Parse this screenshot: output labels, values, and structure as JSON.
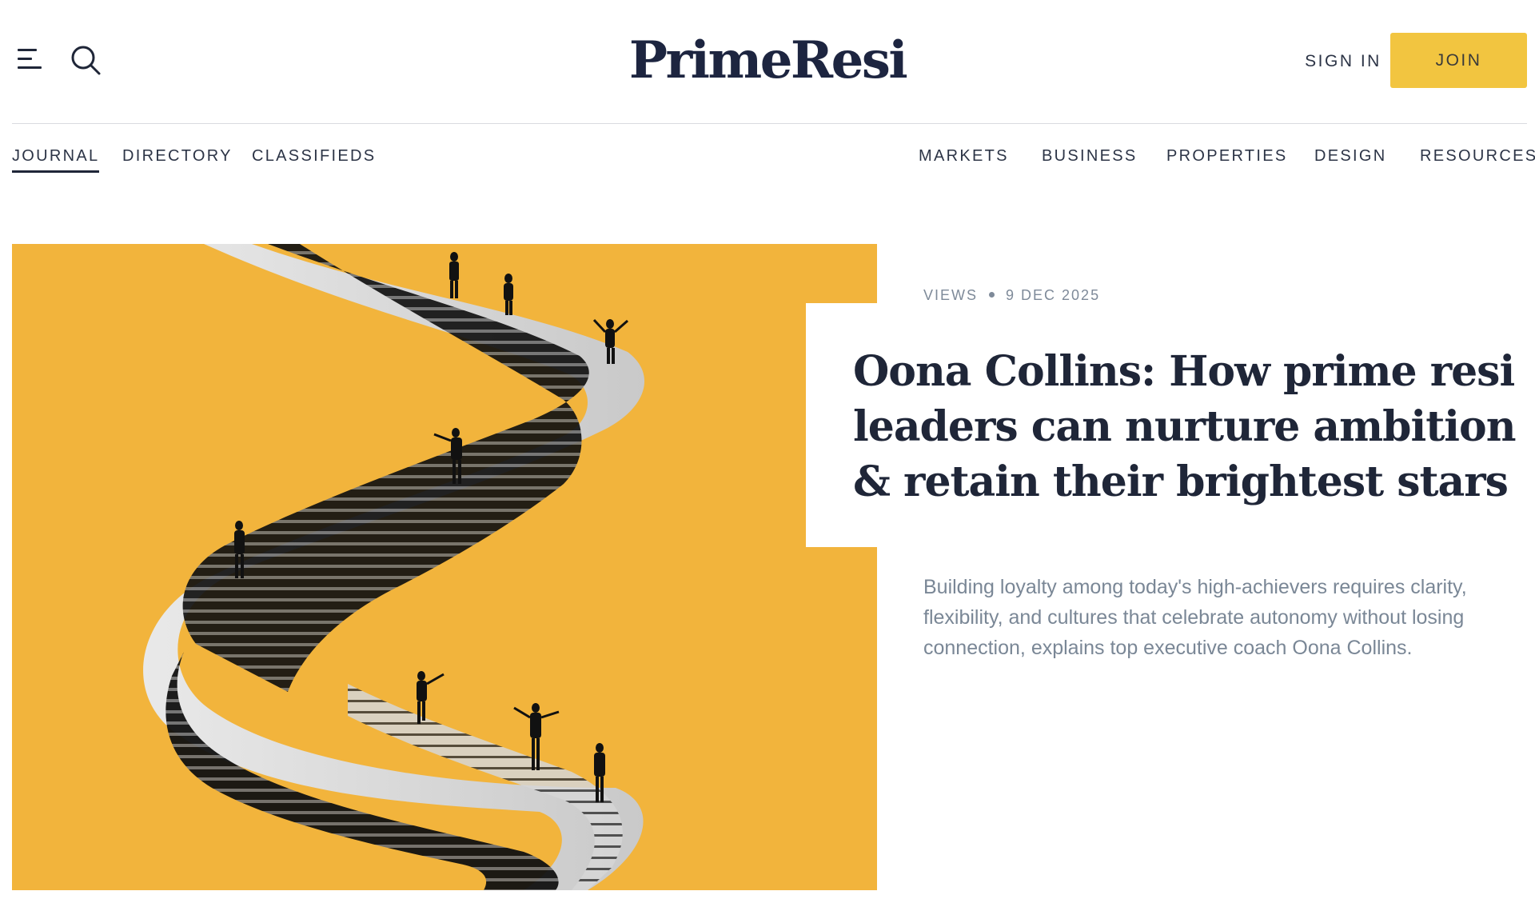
{
  "header": {
    "logo": "PrimeResi",
    "menu_icon": "hamburger-menu-icon",
    "search_icon": "search-icon",
    "sign_in_label": "SIGN IN",
    "join_label": "JOIN",
    "accent_color": "#f2c540"
  },
  "nav": {
    "left": [
      {
        "label": "JOURNAL",
        "active": true
      },
      {
        "label": "DIRECTORY"
      },
      {
        "label": "CLASSIFIEDS"
      }
    ],
    "right": [
      {
        "label": "MARKETS"
      },
      {
        "label": "BUSINESS"
      },
      {
        "label": "PROPERTIES"
      },
      {
        "label": "DESIGN"
      },
      {
        "label": "RESOURCES"
      }
    ]
  },
  "article": {
    "category": "VIEWS",
    "date": "9 DEC 2025",
    "headline": "Oona Collins: How prime resi leaders can nurture ambition & retain their brightest stars",
    "standfirst": "Building loyalty among today's high-achievers requires clarity, flexibility, and cultures that celebrate autonomy without losing connection, explains top executive coach Oona Collins.",
    "image_background": "#f2b43c"
  }
}
